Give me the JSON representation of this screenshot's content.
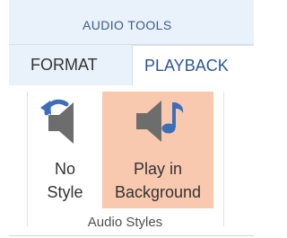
{
  "contextual_tab_group": {
    "title": "AUDIO TOOLS"
  },
  "tabs": [
    {
      "label": "FORMAT",
      "active": false
    },
    {
      "label": "PLAYBACK",
      "active": true
    }
  ],
  "group": {
    "label": "Audio Styles",
    "buttons": [
      {
        "label_line1": "No",
        "label_line2": "Style",
        "icon": "undo-speaker-icon",
        "highlighted": false
      },
      {
        "label_line1": "Play in",
        "label_line2": "Background",
        "icon": "speaker-music-note-icon",
        "highlighted": true
      }
    ]
  },
  "colors": {
    "context_title": "#3b5b8f",
    "active_tab_text": "#2b5797",
    "highlight": "#f8c9ae",
    "icon_gray": "#6d6d6d",
    "icon_blue": "#3d6fb8"
  }
}
